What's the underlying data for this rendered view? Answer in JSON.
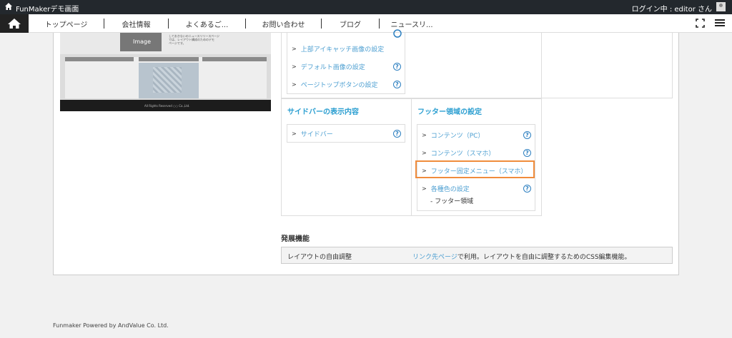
{
  "topbar": {
    "site_title": "FunMakerデモ画面",
    "login_text": "ログイン中 : editor さん"
  },
  "nav": {
    "items": [
      "トップページ",
      "会社情報",
      "よくあるご...",
      "お問い合わせ",
      "ブログ",
      "ニュースリ..."
    ]
  },
  "preview": {
    "image_label": "Image",
    "text_lines": [
      "しておきないのニュースリリースページ",
      "では、レイアウト構成のためのデモ",
      "ページです。"
    ],
    "footer_text": "All Rights Reserved ○○ Co.,Ltd."
  },
  "settings": {
    "top_items": [
      "上部アイキャッチ画像の設定",
      "デフォルト画像の設定",
      "ページトップボタンの設定"
    ],
    "sidebar_title": "サイドバーの表示内容",
    "sidebar_items": [
      "サイドバー"
    ],
    "footer_title": "フッター領域の設定",
    "footer_items": [
      "コンテンツ（PC）",
      "コンテンツ（スマホ）",
      "フッター固定メニュー（スマホ）",
      "各種色の設定"
    ],
    "footer_sub": "- フッター領域",
    "help_icon": "?"
  },
  "advanced": {
    "title": "発展機能",
    "row_label": "レイアウトの自由調整",
    "link_text": "リンク先ページ",
    "desc_text": "で利用。レイアウトを自由に調整するためのCSS編集機能。"
  },
  "footer": {
    "text": "Funmaker Powered by AndValue Co. Ltd."
  },
  "colors": {
    "accent": "#2c9fd1",
    "link": "#4d9fd1",
    "highlight": "#f08c3c"
  }
}
